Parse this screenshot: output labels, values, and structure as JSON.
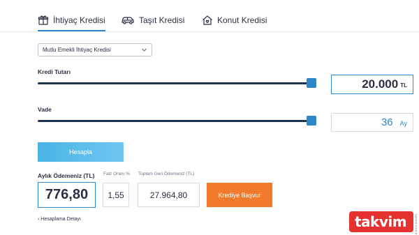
{
  "tabs": [
    {
      "label": "İhtiyaç Kredisi",
      "icon": "gift-icon",
      "active": true
    },
    {
      "label": "Taşıt Kredisi",
      "icon": "car-icon",
      "active": false
    },
    {
      "label": "Konut Kredisi",
      "icon": "house-icon",
      "active": false
    }
  ],
  "loan_type": {
    "selected": "Mutlu Emekli İhtiyaç Kredisi"
  },
  "amount": {
    "label": "Kredi Tutarı",
    "value": "20.000",
    "unit": "TL",
    "slider_fraction": 0.99
  },
  "term": {
    "label": "Vade",
    "value": "36",
    "unit": "Ay",
    "slider_fraction": 0.99
  },
  "calculate_label": "Hesapla",
  "results": {
    "monthly_label": "Aylık Ödemeniz (TL)",
    "monthly_value": "776,80",
    "rate_label": "Faiz Oranı %",
    "rate_value": "1,55",
    "total_label": "Toplam Geri Ödemeniz (TL)",
    "total_value": "27.964,80"
  },
  "apply_label": "Krediye Başvur",
  "detail_label": "Hesaplama Detayı",
  "watermark": {
    "logo_text": "takvim",
    "sub_text": "takvim.com.tr"
  },
  "colors": {
    "accent": "#2d86c7",
    "button_blue": "#49b3e6",
    "apply_orange": "#f27a2c",
    "track": "#1e3350",
    "watermark_red": "#e6322f"
  }
}
